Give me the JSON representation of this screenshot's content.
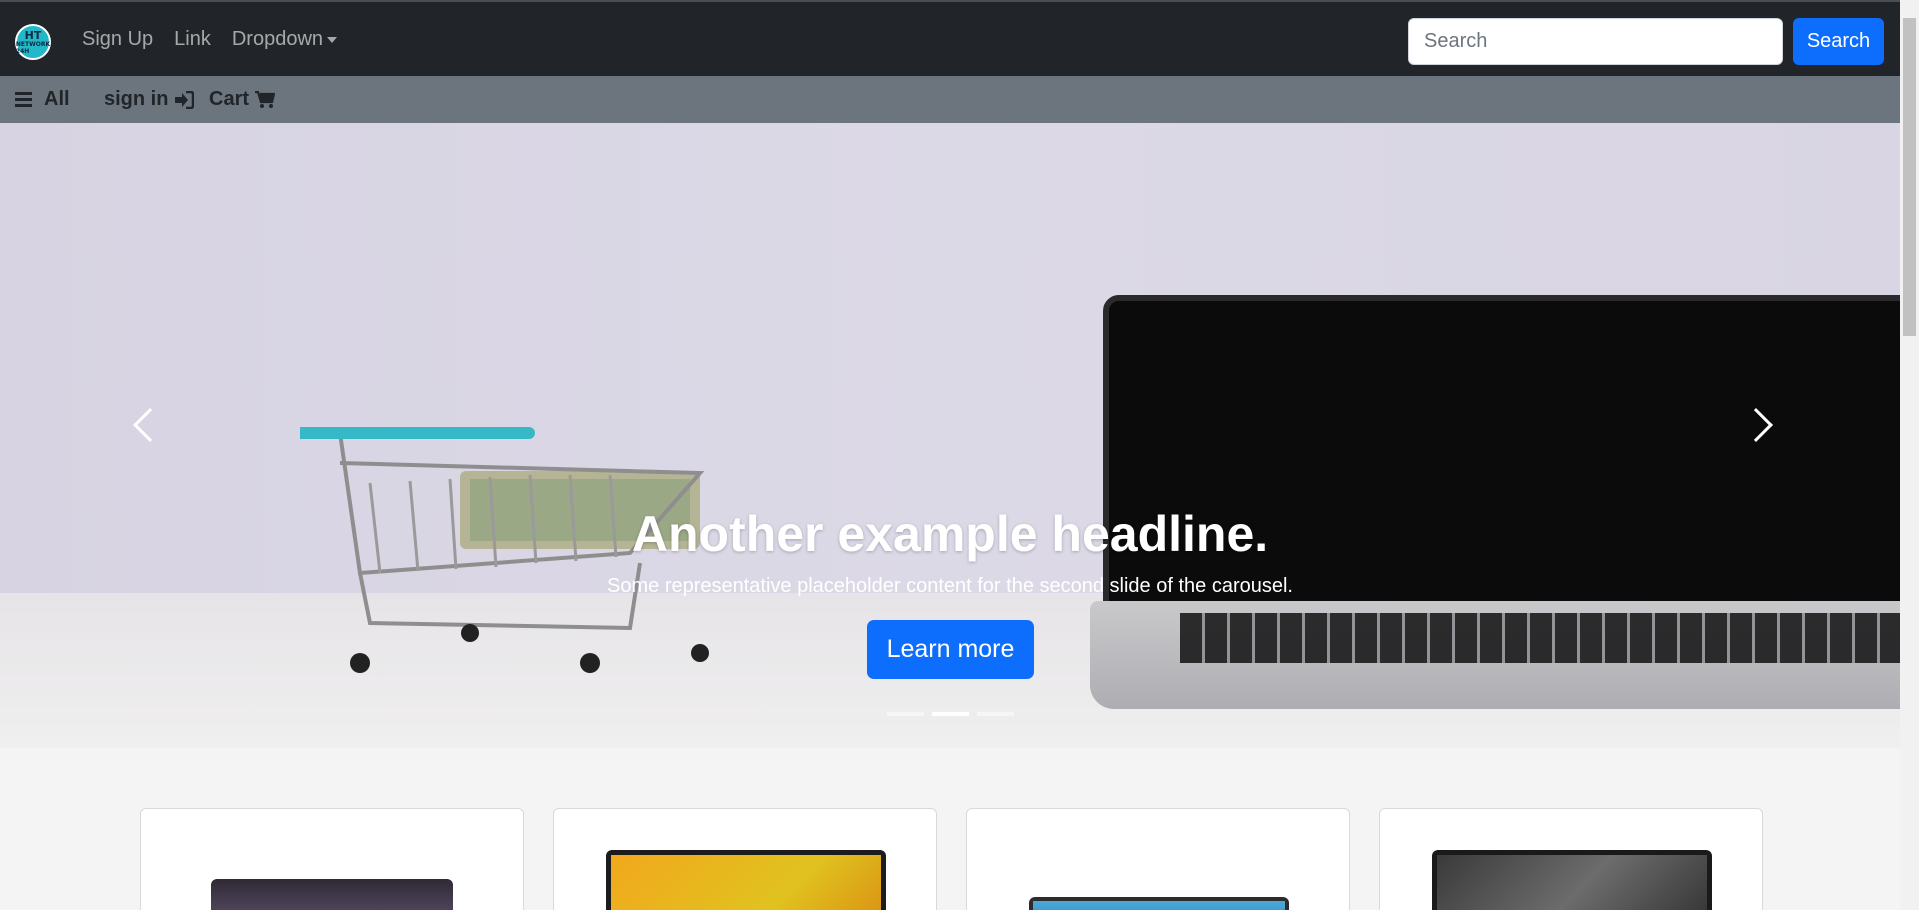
{
  "brand": {
    "logo_line1": "HT",
    "logo_line2": "NETWORK 24H"
  },
  "navbar": {
    "links": [
      "Sign Up",
      "Link",
      "Dropdown"
    ],
    "search_placeholder": "Search",
    "search_button": "Search"
  },
  "subbar": {
    "all": "All",
    "sign_in": "sign in",
    "cart": "Cart"
  },
  "carousel": {
    "headline": "Another example headline.",
    "text": "Some representative placeholder content for the second slide of the carousel.",
    "button": "Learn more",
    "slide_count": 3,
    "active_slide": 2
  },
  "colors": {
    "navbar": "#212529",
    "subbar": "#6c757d",
    "primary": "#0d6efd"
  },
  "icons": [
    "bars-icon",
    "sign-in-icon",
    "cart-icon",
    "chevron-left-icon",
    "chevron-right-icon"
  ]
}
